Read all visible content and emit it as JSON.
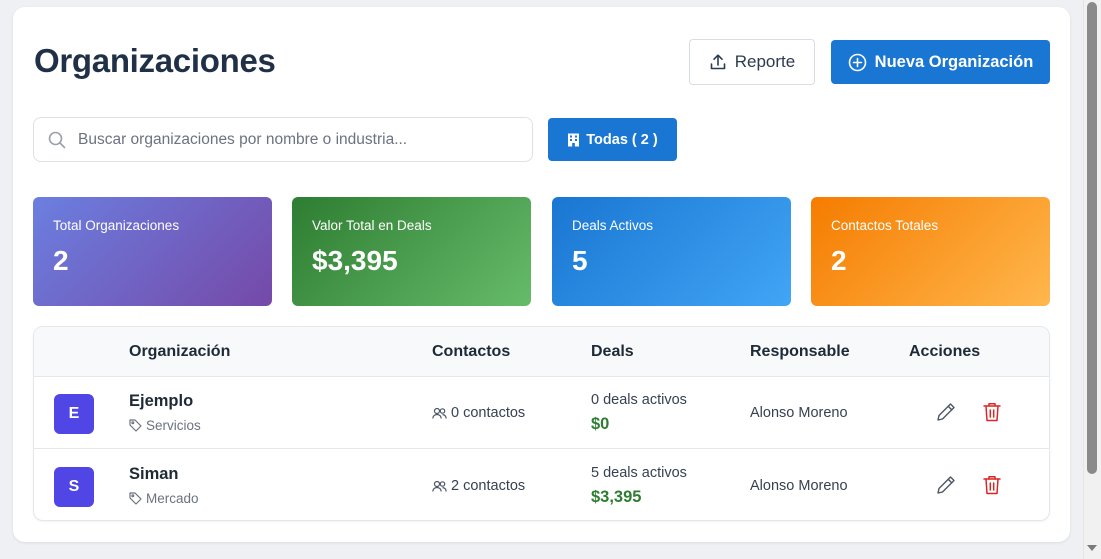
{
  "header": {
    "title": "Organizaciones",
    "report_label": "Reporte",
    "new_label": "Nueva Organización"
  },
  "search": {
    "placeholder": "Buscar organizaciones por nombre o industria..."
  },
  "filter": {
    "label": "Todas ( 2 )"
  },
  "stats": [
    {
      "label": "Total Organizaciones",
      "value": "2"
    },
    {
      "label": "Valor Total en Deals",
      "value": "$3,395"
    },
    {
      "label": "Deals Activos",
      "value": "5"
    },
    {
      "label": "Contactos Totales",
      "value": "2"
    }
  ],
  "table": {
    "columns": [
      "Organización",
      "Contactos",
      "Deals",
      "Responsable",
      "Acciones"
    ],
    "rows": [
      {
        "initial": "E",
        "name": "Ejemplo",
        "industry": "Servicios",
        "contacts": "0 contactos",
        "deals_count": "0 deals activos",
        "deals_value": "$0",
        "owner": "Alonso Moreno"
      },
      {
        "initial": "S",
        "name": "Siman",
        "industry": "Mercado",
        "contacts": "2 contactos",
        "deals_count": "5 deals activos",
        "deals_value": "$3,395",
        "owner": "Alonso Moreno"
      }
    ]
  },
  "colors": {
    "primary": "#1976d2",
    "avatar": "#4f46e5",
    "money": "#2e7d32",
    "delete": "#dc2626"
  },
  "icons": [
    "upload-icon",
    "plus-circle-icon",
    "search-icon",
    "building-icon",
    "tag-icon",
    "users-icon",
    "pencil-icon",
    "trash-icon"
  ]
}
